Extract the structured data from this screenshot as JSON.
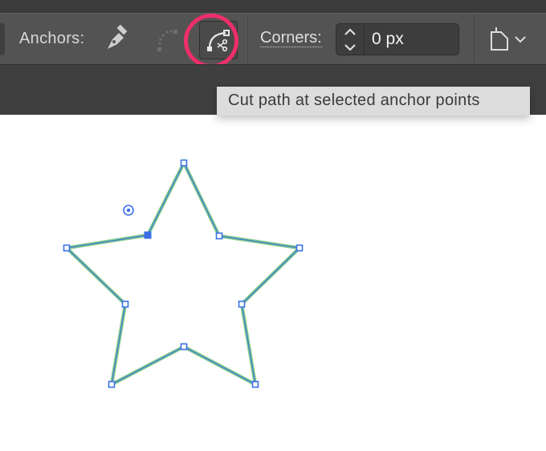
{
  "toolbar": {
    "anchors_label": "Anchors:",
    "corners_label": "Corners:",
    "corners_value": "0 px",
    "tools": [
      {
        "name": "pen-tool",
        "icon": "pen-icon",
        "state": "enabled"
      },
      {
        "name": "smooth-tool",
        "icon": "smooth-anchor-icon",
        "state": "disabled"
      },
      {
        "name": "cut-path-tool",
        "icon": "cut-path-icon",
        "state": "hover-highlighted"
      }
    ]
  },
  "tooltip": {
    "text": "Cut path at selected anchor points"
  },
  "colors": {
    "toolbar_bg": "#535353",
    "highlight_ring": "#ee2e6b",
    "path_stroke": "#3f86c6",
    "path_fill_stroke": "#8fcf8f",
    "anchor_color": "#3a6fe6"
  },
  "canvas": {
    "shape": "five-point-star",
    "anchors_count": 10,
    "selected_anchor_index": 9
  }
}
